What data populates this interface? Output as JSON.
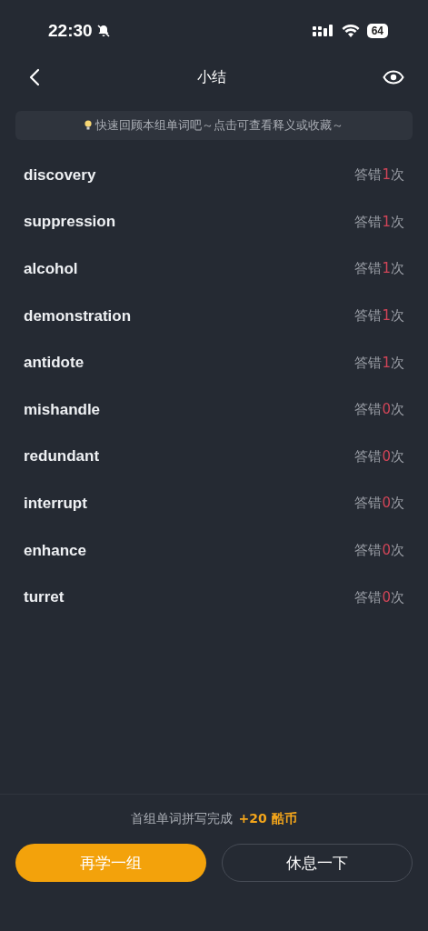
{
  "status_bar": {
    "time": "22:30",
    "battery": "64"
  },
  "header": {
    "title": "小结"
  },
  "tip": "快速回顾本组单词吧～点击可查看释义或收藏～",
  "words": [
    {
      "word": "discovery",
      "before": "答错",
      "count": "1",
      "after": "次"
    },
    {
      "word": "suppression",
      "before": "答错",
      "count": "1",
      "after": "次"
    },
    {
      "word": "alcohol",
      "before": "答错",
      "count": "1",
      "after": "次"
    },
    {
      "word": "demonstration",
      "before": "答错",
      "count": "1",
      "after": "次"
    },
    {
      "word": "antidote",
      "before": "答错",
      "count": "1",
      "after": "次"
    },
    {
      "word": "mishandle",
      "before": "答错",
      "count": "0",
      "after": "次"
    },
    {
      "word": "redundant",
      "before": "答错",
      "count": "0",
      "after": "次"
    },
    {
      "word": "interrupt",
      "before": "答错",
      "count": "0",
      "after": "次"
    },
    {
      "word": "enhance",
      "before": "答错",
      "count": "0",
      "after": "次"
    },
    {
      "word": "turret",
      "before": "答错",
      "count": "0",
      "after": "次"
    }
  ],
  "footer": {
    "message": "首组单词拼写完成",
    "reward": "+20 酷币",
    "buttons": [
      {
        "label": "再学一组",
        "kind": "primary"
      },
      {
        "label": "休息一下",
        "kind": "outline"
      }
    ]
  }
}
